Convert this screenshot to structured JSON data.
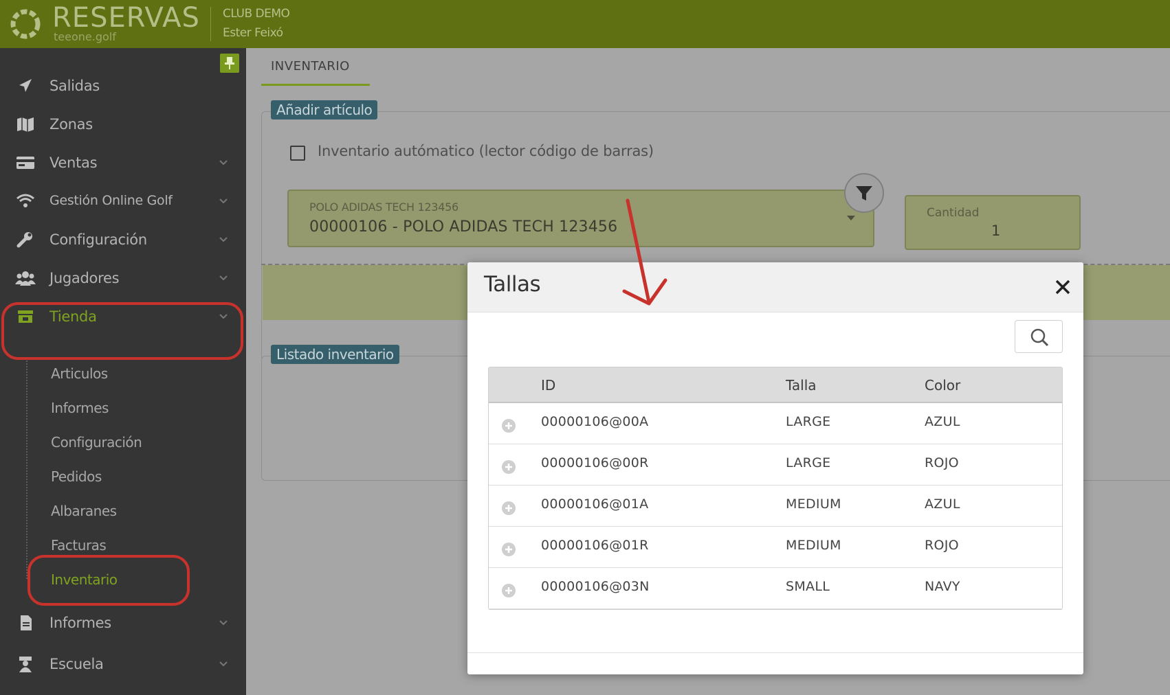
{
  "header": {
    "brand": "RESERVAS",
    "brand_sub": "teeone.golf",
    "club": "CLUB DEMO",
    "user": "Ester Feixó"
  },
  "sidebar": {
    "items": [
      {
        "label": "Salidas",
        "icon": "paper-plane-icon",
        "has_children": false
      },
      {
        "label": "Zonas",
        "icon": "map-icon",
        "has_children": false
      },
      {
        "label": "Ventas",
        "icon": "credit-card-icon",
        "has_children": true
      },
      {
        "label": "Gestión Online Golf",
        "icon": "wifi-icon",
        "has_children": true
      },
      {
        "label": "Configuración",
        "icon": "wrench-icon",
        "has_children": true
      },
      {
        "label": "Jugadores",
        "icon": "users-icon",
        "has_children": true
      },
      {
        "label": "Tienda",
        "icon": "store-icon",
        "has_children": true,
        "active": true
      },
      {
        "label": "Informes",
        "icon": "file-icon",
        "has_children": true
      },
      {
        "label": "Escuela",
        "icon": "teacher-icon",
        "has_children": true
      }
    ],
    "tienda_sub": [
      "Articulos",
      "Informes",
      "Configuración",
      "Pedidos",
      "Albaranes",
      "Facturas",
      "Inventario"
    ],
    "active_sub": "Inventario"
  },
  "main": {
    "tab": "INVENTARIO",
    "add_panel": {
      "legend": "Añadir artículo",
      "checkbox_label": "Inventario autómatico (lector código de barras)",
      "checkbox_checked": false,
      "select_label": "POLO ADIDAS TECH 123456",
      "select_value": "00000106 - POLO ADIDAS TECH 123456",
      "qty_label": "Cantidad",
      "qty_value": "1"
    },
    "list_panel": {
      "legend": "Listado inventario"
    }
  },
  "modal": {
    "title": "Tallas",
    "columns": [
      "ID",
      "Talla",
      "Color"
    ],
    "rows": [
      {
        "id": "00000106@00A",
        "talla": "LARGE",
        "color": "AZUL"
      },
      {
        "id": "00000106@00R",
        "talla": "LARGE",
        "color": "ROJO"
      },
      {
        "id": "00000106@01A",
        "talla": "MEDIUM",
        "color": "AZUL"
      },
      {
        "id": "00000106@01R",
        "talla": "MEDIUM",
        "color": "ROJO"
      },
      {
        "id": "00000106@03N",
        "talla": "SMALL",
        "color": "NAVY"
      }
    ]
  },
  "colors": {
    "header_green": "#5f7012",
    "accent_green": "#7fa320",
    "annotation_red": "#c8322c",
    "legend_teal": "#365f6b"
  }
}
